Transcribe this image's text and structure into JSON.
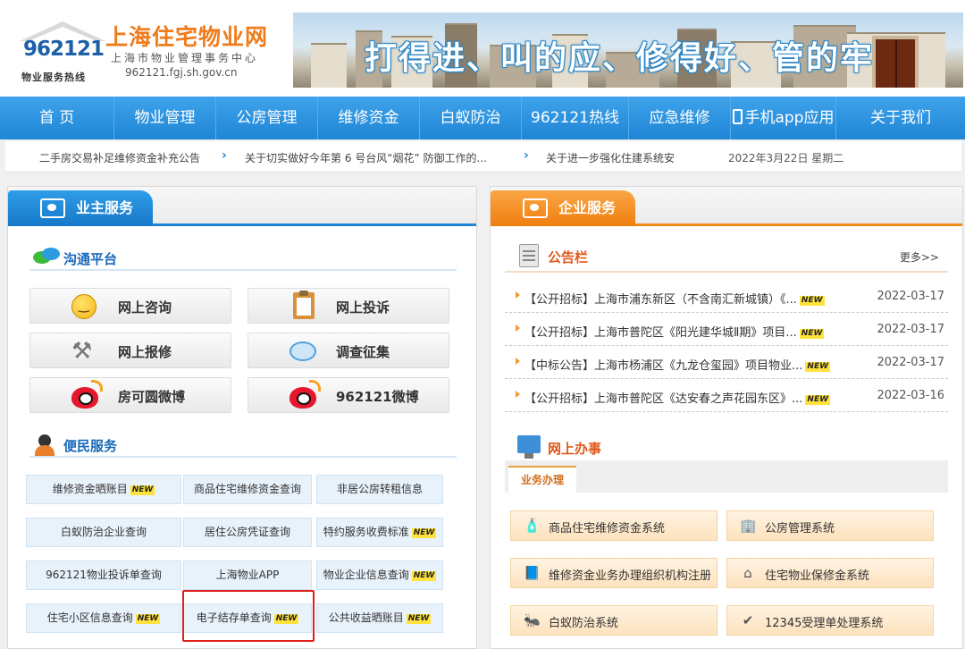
{
  "header": {
    "logo_number": "962121",
    "logo_hotline": "物业服务热线",
    "site_title": "上海住宅物业网",
    "site_subtitle": "上海市物业管理事务中心",
    "site_url": "962121.fgj.sh.gov.cn",
    "banner_slogan": "打得进、叫的应、修得好、管的牢"
  },
  "nav": {
    "items": [
      {
        "label": "首 页",
        "width": 128
      },
      {
        "label": "物业管理",
        "width": 114
      },
      {
        "label": "公房管理",
        "width": 114
      },
      {
        "label": "维修资金",
        "width": 114
      },
      {
        "label": "白蚁防治",
        "width": 114
      },
      {
        "label": "962121热线",
        "width": 120
      },
      {
        "label": "应急维修",
        "width": 114
      },
      {
        "label": "手机app应用",
        "width": 118
      },
      {
        "label": "关于我们",
        "width": 144
      }
    ]
  },
  "ticker": {
    "items": [
      "二手房交易补足维修资金补充公告",
      "关于切实做好今年第 6 号台风“烟花” 防御工作的...",
      "关于进一步强化住建系统安"
    ],
    "date": "2022年3月22日 星期二"
  },
  "owner_service": {
    "tab_label": "业主服务",
    "communication": {
      "title": "沟通平台",
      "buttons": [
        "网上咨询",
        "网上投诉",
        "网上报修",
        "调查征集",
        "房可圆微博",
        "962121微博"
      ]
    },
    "convenience": {
      "title": "便民服务",
      "buttons": [
        {
          "label": "维修资金晒账目",
          "is_new": true
        },
        {
          "label": "商品住宅维修资金查询",
          "is_new": false
        },
        {
          "label": "非居公房转租信息",
          "is_new": false
        },
        {
          "label": "白蚁防治企业查询",
          "is_new": false
        },
        {
          "label": "居住公房凭证查询",
          "is_new": false
        },
        {
          "label": "特约服务收费标准",
          "is_new": true
        },
        {
          "label": "962121物业投诉单查询",
          "is_new": false
        },
        {
          "label": "上海物业APP",
          "is_new": false
        },
        {
          "label": "物业企业信息查询",
          "is_new": true
        },
        {
          "label": "住宅小区信息查询",
          "is_new": true
        },
        {
          "label": "电子结存单查询",
          "is_new": true
        },
        {
          "label": "公共收益晒账目",
          "is_new": true
        }
      ],
      "new_badge": "NEW"
    }
  },
  "enterprise_service": {
    "tab_label": "企业服务",
    "notice_board": {
      "title": "公告栏",
      "more": "更多>>",
      "items": [
        {
          "text": "【公开招标】上海市浦东新区（不含南汇新城镇）《...",
          "date": "2022-03-17"
        },
        {
          "text": "【公开招标】上海市普陀区《阳光建华城Ⅱ期》项目...",
          "date": "2022-03-17"
        },
        {
          "text": "【中标公告】上海市杨浦区《九龙仓玺园》项目物业...",
          "date": "2022-03-17"
        },
        {
          "text": "【公开招标】上海市普陀区《达安春之声花园东区》...",
          "date": "2022-03-16"
        }
      ]
    },
    "online_office": {
      "title": "网上办事",
      "tab": "业务办理",
      "systems": [
        {
          "label": "商品住宅维修资金系统",
          "icon": "bottle-icon"
        },
        {
          "label": "公房管理系统",
          "icon": "buildings-icon"
        },
        {
          "label": "维修资金业务办理组织机构注册",
          "icon": "book-icon"
        },
        {
          "label": "住宅物业保修金系统",
          "icon": "house-icon"
        },
        {
          "label": "白蚁防治系统",
          "icon": "termite-icon"
        },
        {
          "label": "12345受理单处理系统",
          "icon": "check-icon"
        }
      ]
    }
  }
}
